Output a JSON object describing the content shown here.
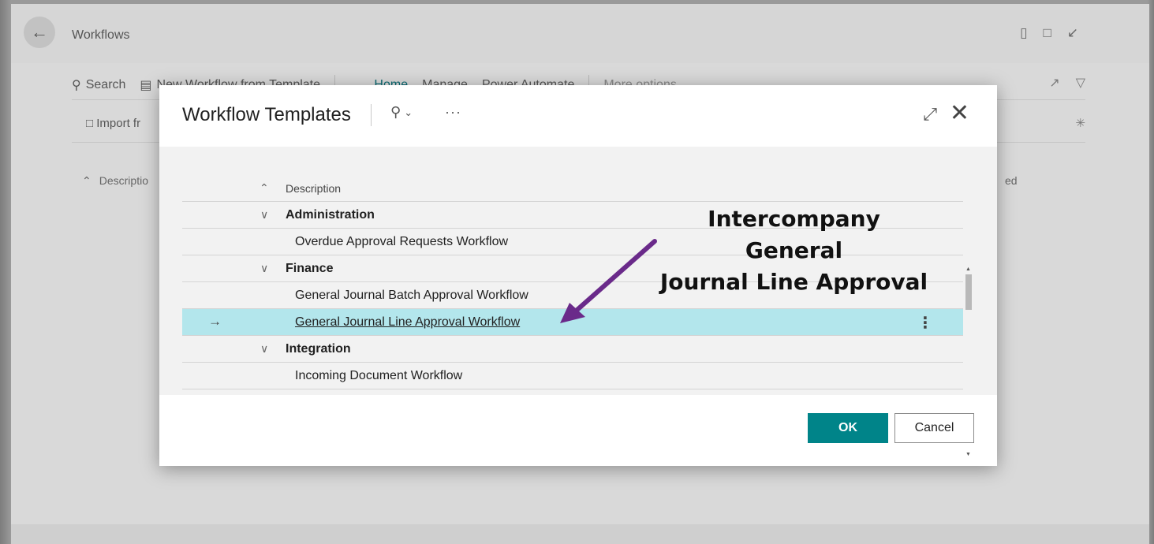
{
  "background_page": {
    "title": "Workflows",
    "actions": {
      "search": "Search",
      "new_from_template": "New Workflow from Template",
      "home": "Home",
      "manage": "Manage",
      "power_automate": "Power Automate",
      "more_options": "More options",
      "import_partial": "Import fr"
    },
    "column_description_partial": "Descriptio",
    "column_right_partial": "ed"
  },
  "modal": {
    "title": "Workflow Templates",
    "more_label": "···",
    "column_header": "Description",
    "rows": [
      {
        "type": "group",
        "label": "Administration"
      },
      {
        "type": "leaf",
        "label": "Overdue Approval Requests Workflow"
      },
      {
        "type": "group",
        "label": "Finance"
      },
      {
        "type": "leaf",
        "label": "General Journal Batch Approval Workflow"
      },
      {
        "type": "leaf",
        "label": "General Journal Line Approval Workflow",
        "selected": true
      },
      {
        "type": "group",
        "label": "Integration"
      },
      {
        "type": "leaf",
        "label": "Incoming Document Workflow"
      }
    ],
    "ok_label": "OK",
    "cancel_label": "Cancel"
  },
  "annotation": {
    "line1": "Intercompany General",
    "line2": "Journal Line Approval",
    "color": "#6a2a8a"
  },
  "colors": {
    "accent": "#008489",
    "selected_row": "#b3e6ec",
    "link_teal": "#0b6a72"
  }
}
